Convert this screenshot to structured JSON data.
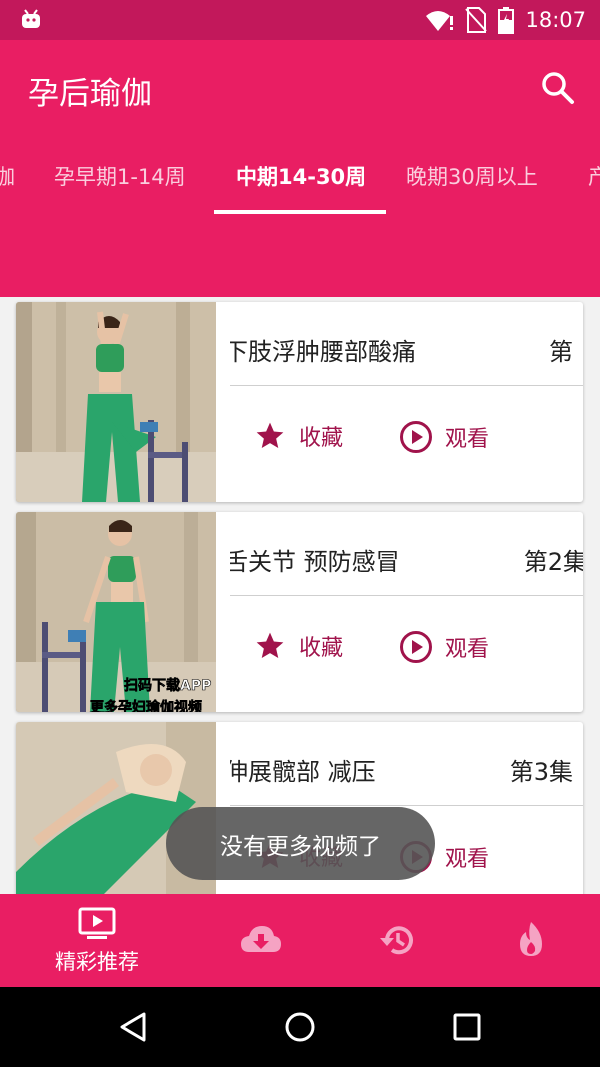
{
  "status_bar": {
    "time": "18:07"
  },
  "app_bar": {
    "title": "孕后瑜伽"
  },
  "tabs": [
    {
      "label": "伽"
    },
    {
      "label": "孕早期1-14周"
    },
    {
      "label": "中期14-30周"
    },
    {
      "label": "晚期30周以上"
    },
    {
      "label": "产"
    }
  ],
  "cards": [
    {
      "title": "下肢浮肿腰部酸痛",
      "episode": "第",
      "fav_label": "收藏",
      "watch_label": "观看"
    },
    {
      "title": "舌关节 预防感冒",
      "episode": "第2集",
      "fav_label": "收藏",
      "watch_label": "观看",
      "watermark": "扫码下载APP",
      "watermark2": "更多孕妇瑜伽视频"
    },
    {
      "title": "伸展髋部 减压",
      "episode": "第3集",
      "fav_label": "收藏",
      "watch_label": "观看"
    }
  ],
  "toast": "没有更多视频了",
  "bottom_nav": [
    {
      "label": "精彩推荐",
      "icon": "video-icon",
      "active": true
    },
    {
      "label": "",
      "icon": "cloud-download-icon"
    },
    {
      "label": "",
      "icon": "history-icon"
    },
    {
      "label": "",
      "icon": "fire-icon"
    }
  ],
  "colors": {
    "primary": "#e91e63",
    "status_bar": "#c2185b",
    "accent_text": "#a0134b"
  }
}
